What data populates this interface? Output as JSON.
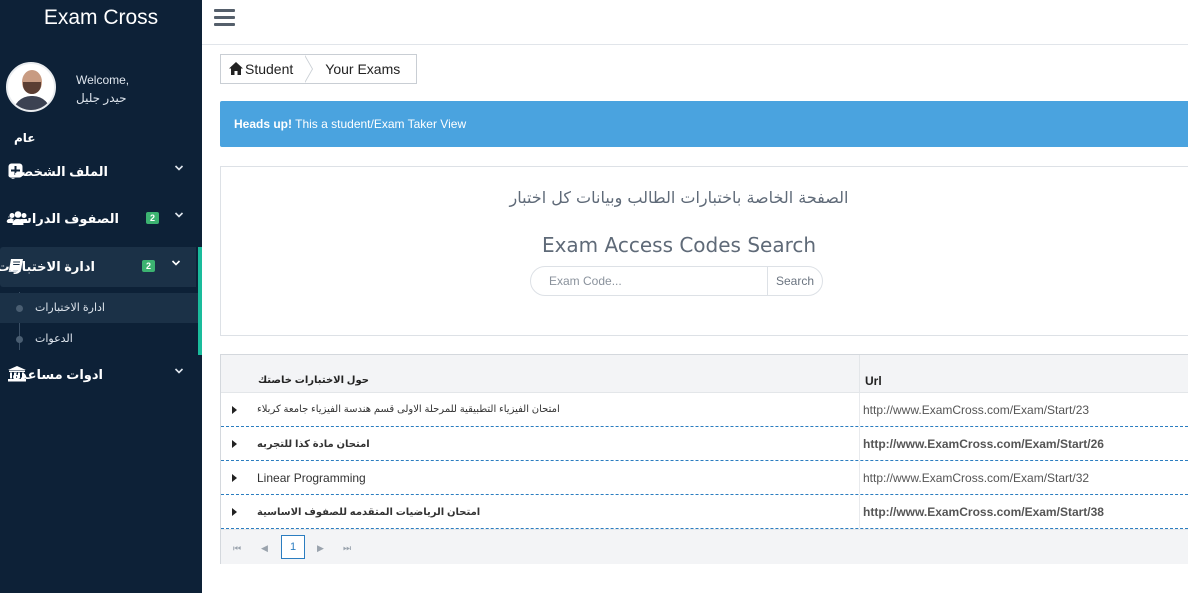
{
  "app": {
    "brand": "Exam Cross"
  },
  "user": {
    "welcome": "Welcome,",
    "name": "حيدر جليل",
    "role": "عام"
  },
  "sidebar": {
    "items": [
      {
        "label": "الملف الشخصي",
        "icon": "plus-square-icon"
      },
      {
        "label": "الصفوف الدراسية",
        "icon": "users-icon",
        "badge": "2"
      },
      {
        "label": "ادارة الاختبارات",
        "icon": "book-icon",
        "badge": "2"
      },
      {
        "label": "ادوات مساعدة",
        "icon": "bank-icon"
      }
    ],
    "subitems": [
      {
        "label": "ادارة الاختبارات"
      },
      {
        "label": "الدعوات"
      }
    ]
  },
  "breadcrumb": {
    "home": "Student",
    "current": "Your Exams"
  },
  "alert": {
    "strong": "Heads up!",
    "text": " This a student/Exam Taker View"
  },
  "search": {
    "subtitle": "الصفحة الخاصة باختبارات الطالب وبيانات كل اختبار",
    "title": "Exam Access Codes Search",
    "placeholder": "Exam Code...",
    "button": "Search"
  },
  "grid": {
    "headers": {
      "name": "حول الاختبارات خاصتك",
      "url": "Url"
    },
    "rows": [
      {
        "name": "امتحان الفيزياء التطبيقية للمرحلة الاولى قسم هندسة الفيزياء جامعة كربلاء",
        "url": "http://www.ExamCross.com/Exam/Start/23"
      },
      {
        "name": "امتحان مادة كذا للتجربه",
        "url": "http://www.ExamCross.com/Exam/Start/26"
      },
      {
        "name": "Linear Programming",
        "url": "http://www.ExamCross.com/Exam/Start/32"
      },
      {
        "name": "امتحان الرياضيات المتقدمه للصفوف الاساسية",
        "url": "http://www.ExamCross.com/Exam/Start/38"
      }
    ],
    "pager": {
      "first": "⏮",
      "prev": "◀",
      "current": "1",
      "next": "▶",
      "last": "⏭"
    }
  }
}
